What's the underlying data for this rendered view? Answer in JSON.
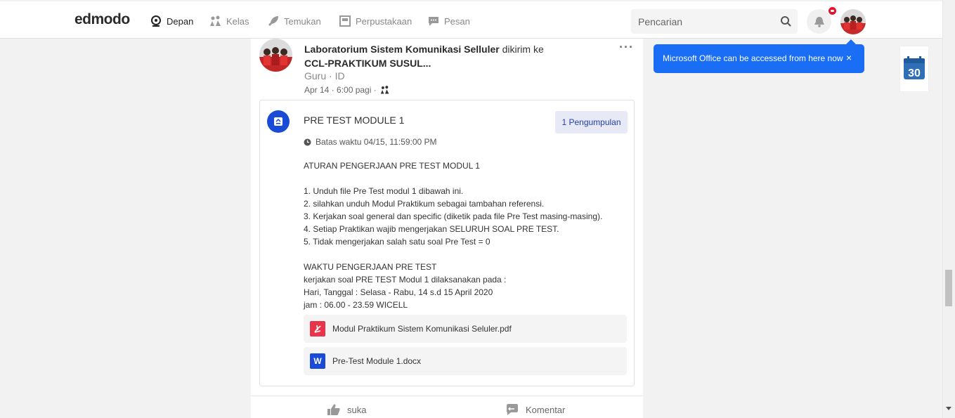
{
  "topbar": {
    "logo": "edmodo",
    "nav": [
      {
        "label": "Depan",
        "icon": "home-icon"
      },
      {
        "label": "Kelas",
        "icon": "classes-icon"
      },
      {
        "label": "Temukan",
        "icon": "rocket-icon"
      },
      {
        "label": "Perpustakaan",
        "icon": "library-icon"
      },
      {
        "label": "Pesan",
        "icon": "message-icon"
      }
    ],
    "search_placeholder": "Pencarian"
  },
  "post": {
    "sender": "Laboratorium Sistem Komunikasi Selluler",
    "sent_to_text": " dikirim ke",
    "group": "CCL-PRAKTIKUM SUSUL...",
    "role": "Guru · ID",
    "date": "Apr 14 · 6:00 pagi ·",
    "assignment": {
      "title": "PRE TEST MODULE 1",
      "submissions_label": "1 Pengumpulan",
      "deadline": "Batas waktu 04/15, 11:59:00 PM",
      "description_lines": [
        "ATURAN PENGERJAAN PRE TEST MODUL 1",
        "",
        "1. Unduh file Pre Test modul 1 dibawah ini.",
        "2. silahkan unduh Modul Praktikum sebagai tambahan referensi.",
        "3. Kerjakan soal general dan specific (diketik pada file Pre Test masing-masing).",
        "4. Setiap Praktikan wajib mengerjakan SELURUH SOAL PRE TEST.",
        "5. Tidak mengerjakan salah satu soal Pre Test = 0",
        "",
        "WAKTU PENGERJAAN PRE TEST",
        "kerjakan soal PRE TEST Modul 1 dilaksanakan pada :",
        "Hari, Tanggal : Selasa - Rabu, 14 s.d 15 April 2020",
        "jam : 06.00 - 23.59 WICELL"
      ],
      "attachments": [
        {
          "name": "Modul Praktikum Sistem Komunikasi Seluler.pdf",
          "type": "pdf"
        },
        {
          "name": "Pre-Test Module 1.docx",
          "type": "docx"
        }
      ]
    },
    "actions": {
      "like": "suka",
      "comment": "Komentar"
    }
  },
  "toast": {
    "text": "Microsoft Office can be accessed from here now",
    "close": "×"
  },
  "calendar_widget": {
    "day": "30"
  },
  "colors": {
    "accent": "#1a6ef5",
    "badge": "#e8112d",
    "pdf": "#e8344a",
    "word": "#1a4bd6"
  }
}
